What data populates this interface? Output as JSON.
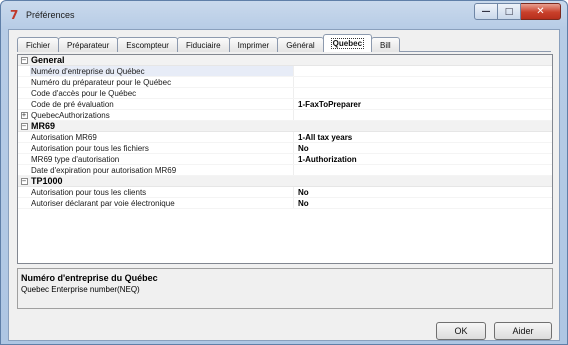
{
  "window": {
    "title": "Préférences",
    "buttons": {
      "minimize": "—",
      "maximize": "□",
      "close": "✕"
    }
  },
  "tabs": [
    {
      "label": "Fichier"
    },
    {
      "label": "Préparateur"
    },
    {
      "label": "Escompteur"
    },
    {
      "label": "Fiduciaire"
    },
    {
      "label": "Imprimer"
    },
    {
      "label": "Général"
    },
    {
      "label": "Quebec",
      "active": true
    },
    {
      "label": "Bill"
    }
  ],
  "grid": {
    "categories": [
      {
        "title": "General",
        "toggle": "−",
        "rows": [
          {
            "name": "Numéro d'entreprise du Québec",
            "value": "",
            "selected": true
          },
          {
            "name": "Numéro du préparateur pour le Québec",
            "value": ""
          },
          {
            "name": "Code d'accès pour le Québec",
            "value": ""
          },
          {
            "name": "Code de pré évaluation",
            "value": "1-FaxToPreparer"
          },
          {
            "name": "QuebecAuthorizations",
            "value": "",
            "toggle": "+"
          }
        ]
      },
      {
        "title": "MR69",
        "toggle": "−",
        "rows": [
          {
            "name": "Autorisation MR69",
            "value": "1-All tax years"
          },
          {
            "name": "Autorisation pour tous les fichiers",
            "value": "No"
          },
          {
            "name": "MR69 type d'autorisation",
            "value": "1-Authorization"
          },
          {
            "name": "Date d'expiration pour autorisation MR69",
            "value": ""
          }
        ]
      },
      {
        "title": "TP1000",
        "toggle": "−",
        "rows": [
          {
            "name": "Autorisation pour tous les clients",
            "value": "No"
          },
          {
            "name": "Autoriser déclarant  par voie électronique",
            "value": "No"
          }
        ]
      }
    ]
  },
  "description": {
    "title": "Numéro d'entreprise du Québec",
    "text": "Quebec Enterprise number(NEQ)"
  },
  "footer": {
    "ok_label": "OK",
    "help_label": "Aider"
  },
  "colors": {
    "title_bar": "#b7cce6",
    "close_button": "#c9402b",
    "grid_category": "#f2f2f2"
  }
}
